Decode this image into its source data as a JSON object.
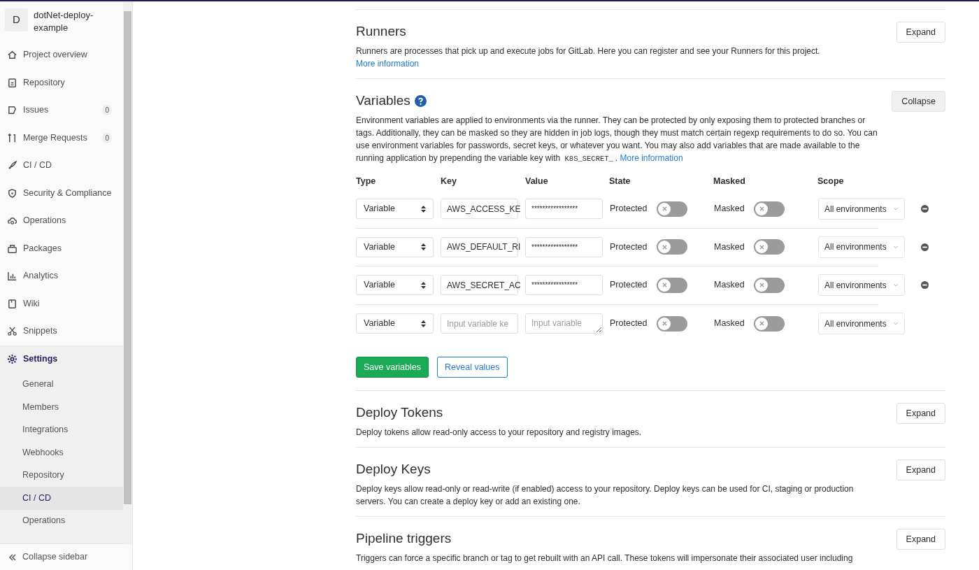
{
  "sidebar": {
    "project": {
      "avatar": "D",
      "name": "dotNet-deploy-example"
    },
    "items": [
      {
        "label": "Project overview",
        "selected": false
      },
      {
        "label": "Repository",
        "selected": false
      },
      {
        "label": "Issues",
        "count": "0",
        "selected": false
      },
      {
        "label": "Merge Requests",
        "count": "0",
        "selected": false
      },
      {
        "label": "CI / CD",
        "selected": false
      },
      {
        "label": "Security & Compliance",
        "selected": false
      },
      {
        "label": "Operations",
        "selected": false
      },
      {
        "label": "Packages",
        "selected": false
      },
      {
        "label": "Analytics",
        "selected": false
      },
      {
        "label": "Wiki",
        "selected": false
      },
      {
        "label": "Snippets",
        "selected": false
      },
      {
        "label": "Settings",
        "selected": true,
        "children": [
          {
            "label": "General",
            "selected": false
          },
          {
            "label": "Members",
            "selected": false
          },
          {
            "label": "Integrations",
            "selected": false
          },
          {
            "label": "Webhooks",
            "selected": false
          },
          {
            "label": "Repository",
            "selected": false
          },
          {
            "label": "CI / CD",
            "selected": true
          },
          {
            "label": "Operations",
            "selected": false
          }
        ]
      }
    ],
    "collapse": "Collapse sidebar"
  },
  "sections": [
    {
      "kind": "plain",
      "title": "Runners",
      "button": "Expand",
      "expanded": false,
      "description": [
        {
          "kind": "text",
          "text": "Runners are processes that pick up and execute jobs for GitLab. Here you can register and see your Runners for this project. "
        },
        {
          "kind": "link",
          "text": "More information"
        }
      ]
    },
    {
      "kind": "variables",
      "title": "Variables",
      "help": true,
      "button": "Collapse",
      "expanded": true,
      "description": [
        {
          "kind": "text",
          "text": "Environment variables are applied to environments via the runner. They can be protected by only exposing them to protected branches or tags. Additionally, they can be masked so they are hidden in job logs, though they must match certain regexp requirements to do so. You can use environment variables for passwords, secret keys, or whatever you want. You may also add variables that are made available to the running application by prepending the variable key with "
        },
        {
          "kind": "code",
          "text": "K8S_SECRET_"
        },
        {
          "kind": "text",
          "text": ". "
        },
        {
          "kind": "link",
          "text": "More information"
        }
      ],
      "columns": [
        "Type",
        "Key",
        "Value",
        "State",
        "Masked",
        "Scope"
      ],
      "rows": [
        {
          "type": "Variable",
          "key": "AWS_ACCESS_KE",
          "value": "*****************",
          "state_label": "Protected",
          "protected": false,
          "masked_label": "Masked",
          "masked": false,
          "scope": "All environments",
          "removable": true
        },
        {
          "type": "Variable",
          "key": "AWS_DEFAULT_RI",
          "value": "*****************",
          "state_label": "Protected",
          "protected": false,
          "masked_label": "Masked",
          "masked": false,
          "scope": "All environments",
          "removable": true
        },
        {
          "type": "Variable",
          "key": "AWS_SECRET_AC",
          "value": "*****************",
          "state_label": "Protected",
          "protected": false,
          "masked_label": "Masked",
          "masked": false,
          "scope": "All environments",
          "removable": true
        },
        {
          "type": "Variable",
          "key_placeholder": "Input variable ke",
          "value_placeholder": "Input variable",
          "state_label": "Protected",
          "protected": false,
          "masked_label": "Masked",
          "masked": false,
          "scope": "All environments",
          "removable": false
        }
      ],
      "actions": [
        {
          "label": "Save variables",
          "kind": "primary"
        },
        {
          "label": "Reveal values",
          "kind": "outline"
        }
      ]
    },
    {
      "kind": "plain",
      "title": "Deploy Tokens",
      "button": "Expand",
      "expanded": false,
      "description": [
        {
          "kind": "text",
          "text": "Deploy tokens allow read-only access to your repository and registry images."
        }
      ]
    },
    {
      "kind": "plain",
      "title": "Deploy Keys",
      "button": "Expand",
      "expanded": false,
      "description": [
        {
          "kind": "text",
          "text": "Deploy keys allow read-only or read-write (if enabled) access to your repository. Deploy keys can be used for CI, staging or production servers. You can create a deploy key or add an existing one."
        }
      ]
    },
    {
      "kind": "plain",
      "title": "Pipeline triggers",
      "button": "Expand",
      "expanded": false,
      "description": [
        {
          "kind": "text",
          "text": "Triggers can force a specific branch or tag to get rebuilt with an API call. These tokens will impersonate their associated user including"
        }
      ]
    }
  ]
}
